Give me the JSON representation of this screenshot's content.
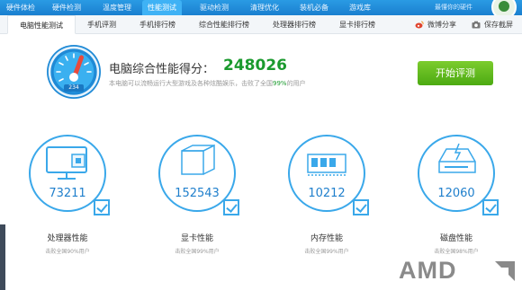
{
  "topnav": {
    "items": [
      "硬件体检",
      "硬件检测",
      "温度管理",
      "性能测试",
      "驱动检测",
      "清理优化",
      "装机必备",
      "游戏库"
    ],
    "active_index": 3,
    "slogan": "最懂你的硬件"
  },
  "tabs": {
    "items": [
      "电脑性能测试",
      "手机评测",
      "手机排行榜",
      "综合性能排行榜",
      "处理器排行榜",
      "显卡排行榜"
    ],
    "active_index": 0
  },
  "actions": {
    "share": "微博分享",
    "screenshot": "保存截屏"
  },
  "score": {
    "title": "电脑综合性能得分：",
    "value": "248026",
    "gauge_label": "234",
    "desc_before": "本电脑可以流畅运行大型游戏及各种炫酷娱乐，击败了全国",
    "desc_pct": "99%",
    "desc_after": "的用户",
    "start_button": "开始评测"
  },
  "cards": [
    {
      "score": "73211",
      "name": "处理器性能",
      "sub": "击败全国90%用户",
      "icon": "cpu-monitor-icon"
    },
    {
      "score": "152543",
      "name": "显卡性能",
      "sub": "击败全国99%用户",
      "icon": "graphics-card-icon"
    },
    {
      "score": "10212",
      "name": "内存性能",
      "sub": "击败全国99%用户",
      "icon": "memory-icon"
    },
    {
      "score": "12060",
      "name": "磁盘性能",
      "sub": "击败全国98%用户",
      "icon": "disk-icon"
    }
  ],
  "watermark": "AMD",
  "colors": {
    "accent": "#1f8ad6",
    "score_green": "#1b9a2e",
    "button_green": "#5cb81e"
  }
}
